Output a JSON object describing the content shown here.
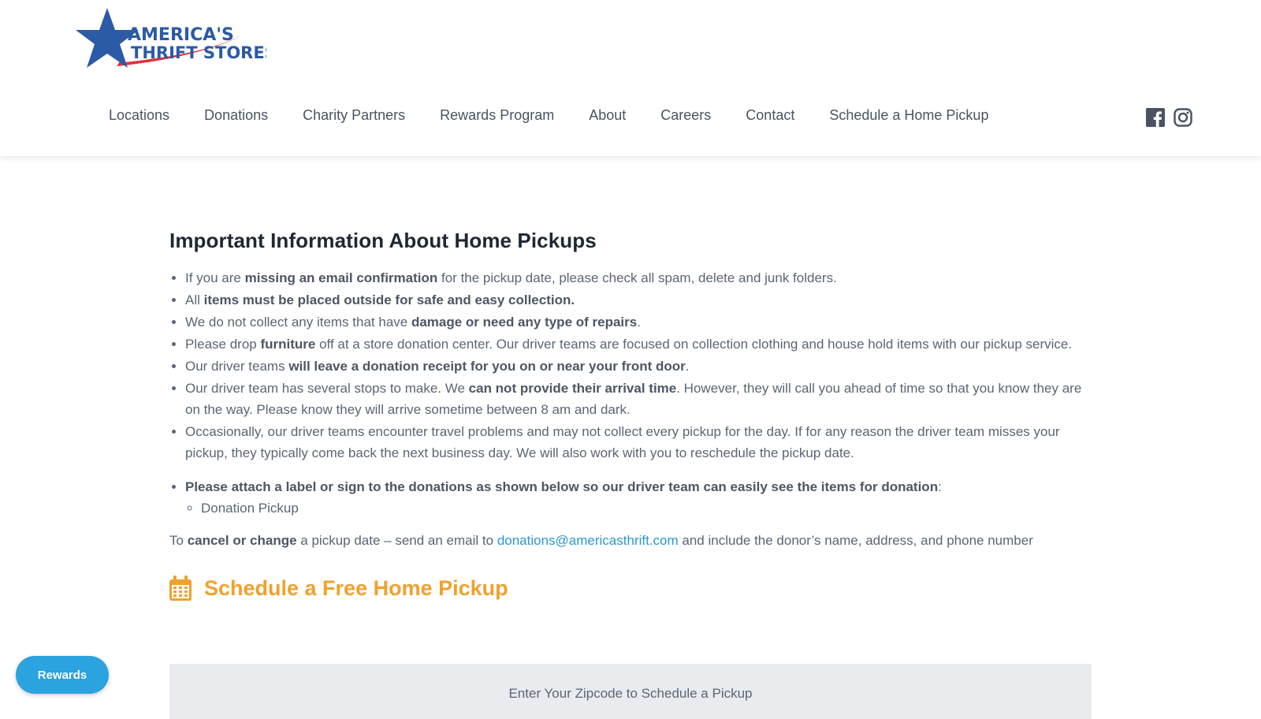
{
  "brand": {
    "logo_text_line1": "AMERICA'S",
    "logo_text_line2": "THRIFT STORES",
    "colors": {
      "blue": "#2b5aa6",
      "red": "#e0323c",
      "orange": "#f0a12d",
      "link": "#2a98d3"
    }
  },
  "nav": {
    "items": [
      {
        "label": "Locations"
      },
      {
        "label": "Donations"
      },
      {
        "label": "Charity Partners"
      },
      {
        "label": "Rewards Program"
      },
      {
        "label": "About"
      },
      {
        "label": "Careers"
      },
      {
        "label": "Contact"
      },
      {
        "label": "Schedule a Home Pickup"
      }
    ],
    "social_icons": [
      "facebook-icon",
      "instagram-icon"
    ]
  },
  "main": {
    "title": "Important Information About Home Pickups",
    "bullets": [
      {
        "pre": "If you are ",
        "bold": "missing an email confirmation",
        "post": " for the pickup date, please check all spam, delete and junk folders."
      },
      {
        "pre": "All ",
        "bold": "items must be placed outside for safe and easy collection.",
        "post": ""
      },
      {
        "pre": "We do not collect any items that have ",
        "bold": "damage or need any type of repairs",
        "post": "."
      },
      {
        "pre": "Please drop ",
        "bold": "furniture",
        "post": " off at a store donation center. Our driver teams are focused on collection clothing and house hold items with our pickup service."
      },
      {
        "pre": "Our driver teams ",
        "bold": "will leave a donation receipt for you on or near your front door",
        "post": "."
      },
      {
        "pre": "Our driver team has several stops to make.  We ",
        "bold": "can not provide their arrival time",
        "post": ".  However, they will call you ahead of time so that you know they are on the way.  Please know they will arrive sometime between 8 am and dark."
      },
      {
        "pre": "Occasionally, our driver teams encounter travel problems and may not collect every pickup for the day. If for any reason the driver team misses your pickup, they typically come back the next business day. We will also work with you to reschedule the pickup date.",
        "bold": "",
        "post": ""
      }
    ],
    "label_bullet": {
      "bold": "Please attach a label or sign to the donations as shown below so our driver team can easily see the items for donation",
      "post": ":",
      "sub_item": "Donation Pickup"
    },
    "cancel": {
      "pre": "To ",
      "bold": "cancel or change",
      "mid": " a pickup date – send an email to ",
      "email": "donations@americasthrift.com",
      "post": " and include the donor’s name, address, and phone number"
    },
    "schedule_title": "Schedule a Free Home Pickup",
    "zip_label": "Enter Your Zipcode to Schedule a Pickup"
  },
  "rewards_button": "Rewards"
}
